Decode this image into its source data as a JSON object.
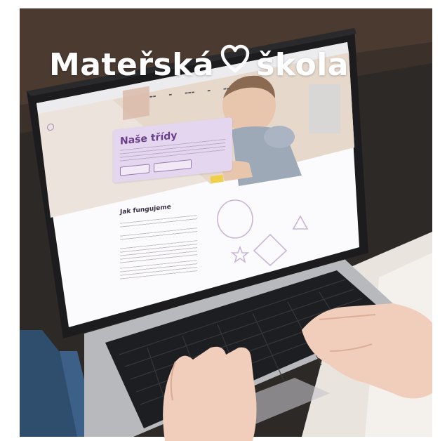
{
  "headline": {
    "word1": "Mateřská",
    "word2": "škola",
    "heart_icon": "heart-outline-icon"
  },
  "laptop_site": {
    "hero_title": "Naše třídy",
    "section_title": "Jak fungujeme"
  },
  "colors": {
    "headline_text": "#ffffff",
    "hero_card": "#e4d6ee",
    "hero_title": "#6a3f8a",
    "shape_outline": "#c9b6d6"
  }
}
